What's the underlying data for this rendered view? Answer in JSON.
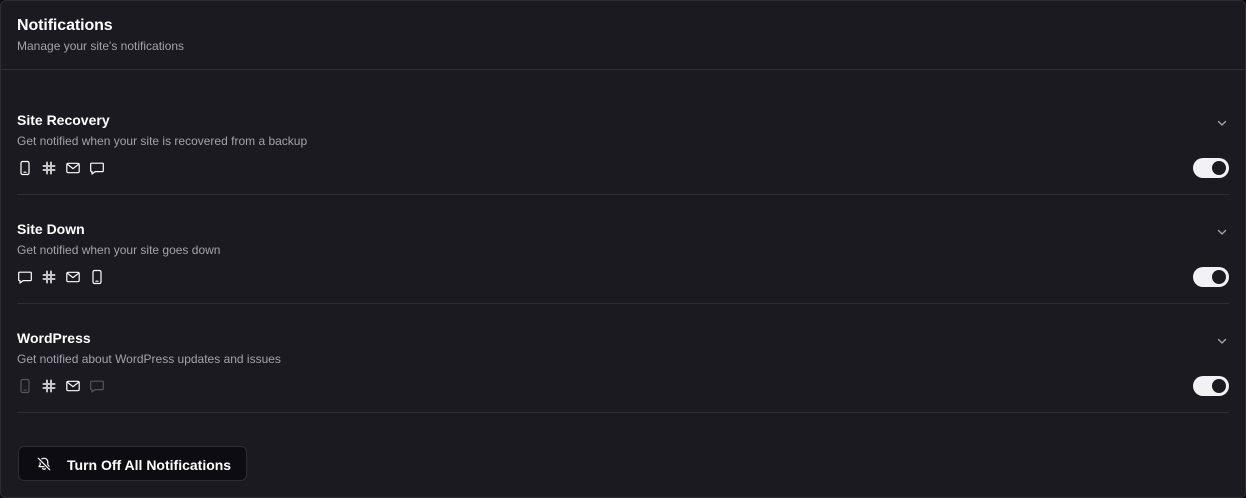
{
  "header": {
    "title": "Notifications",
    "subtitle": "Manage your site's notifications"
  },
  "sections": [
    {
      "title": "Site Recovery",
      "description": "Get notified when your site is recovered from a backup",
      "channels": [
        {
          "icon": "mobile-icon",
          "enabled": true
        },
        {
          "icon": "slack-icon",
          "enabled": true
        },
        {
          "icon": "email-icon",
          "enabled": true
        },
        {
          "icon": "chat-icon",
          "enabled": true
        }
      ],
      "toggle_on": true
    },
    {
      "title": "Site Down",
      "description": "Get notified when your site goes down",
      "channels": [
        {
          "icon": "chat-icon",
          "enabled": true
        },
        {
          "icon": "slack-icon",
          "enabled": true
        },
        {
          "icon": "email-icon",
          "enabled": true
        },
        {
          "icon": "mobile-icon",
          "enabled": true
        }
      ],
      "toggle_on": true
    },
    {
      "title": "WordPress",
      "description": "Get notified about WordPress updates and issues",
      "channels": [
        {
          "icon": "mobile-icon",
          "enabled": false
        },
        {
          "icon": "slack-icon",
          "enabled": true
        },
        {
          "icon": "email-icon",
          "enabled": true
        },
        {
          "icon": "chat-icon",
          "enabled": false
        }
      ],
      "toggle_on": true
    }
  ],
  "turn_off_button": {
    "label": "Turn Off All Notifications",
    "icon": "bell-off-icon"
  },
  "colors": {
    "background": "#1b1a20",
    "border": "#2e2d35",
    "muted_text": "#a3a3ad",
    "icon_enabled": "#ffffff",
    "icon_disabled": "#55545c"
  }
}
